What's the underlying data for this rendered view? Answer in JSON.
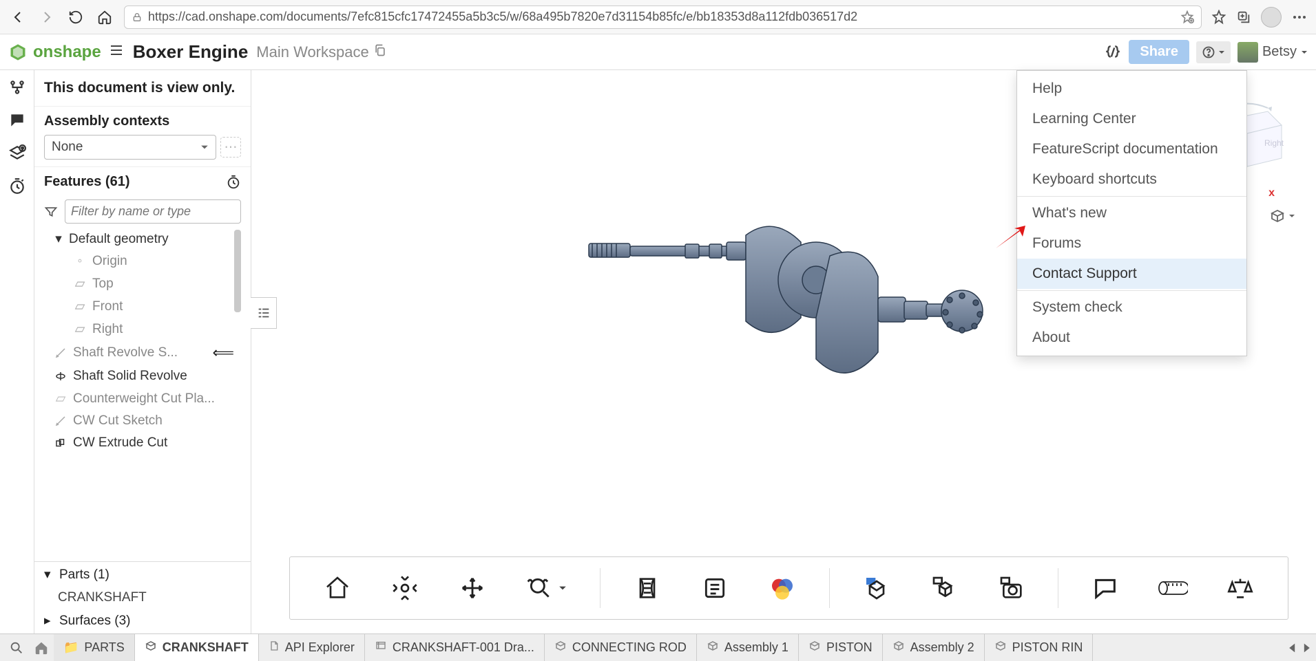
{
  "browser": {
    "url": "https://cad.onshape.com/documents/7efc815cfc17472455a5b3c5/w/68a495b7820e7d31154b85fc/e/bb18353d8a112fdb036517d2"
  },
  "header": {
    "brand": "onshape",
    "doc_title": "Boxer Engine",
    "workspace": "Main Workspace",
    "share_label": "Share",
    "user_name": "Betsy"
  },
  "banner": {
    "view_only": "This document is view only."
  },
  "contexts": {
    "title": "Assembly contexts",
    "selected": "None"
  },
  "features": {
    "title": "Features (61)",
    "filter_placeholder": "Filter by name or type",
    "default_geometry": "Default geometry",
    "items": {
      "origin": "Origin",
      "top": "Top",
      "front": "Front",
      "right": "Right",
      "shaft_rev_sketch": "Shaft Revolve S...",
      "shaft_solid_rev": "Shaft Solid Revolve",
      "cw_cut_plane": "Counterweight Cut Pla...",
      "cw_cut_sketch": "CW Cut Sketch",
      "cw_extrude_cut": "CW Extrude Cut"
    }
  },
  "parts": {
    "title": "Parts (1)",
    "item": "CRANKSHAFT",
    "surfaces": "Surfaces (3)"
  },
  "help_menu": {
    "help": "Help",
    "learning": "Learning Center",
    "fs_doc": "FeatureScript documentation",
    "shortcuts": "Keyboard shortcuts",
    "whats_new": "What's new",
    "forums": "Forums",
    "contact": "Contact Support",
    "system_check": "System check",
    "about": "About"
  },
  "axis": {
    "x": "x"
  },
  "tabs": {
    "parts_folder": "PARTS",
    "crankshaft": "CRANKSHAFT",
    "api_explorer": "API Explorer",
    "crankshaft_drawing": "CRANKSHAFT-001 Dra...",
    "connecting_rod": "CONNECTING ROD",
    "assembly1": "Assembly 1",
    "piston": "PISTON",
    "assembly2": "Assembly 2",
    "piston_ring": "PISTON RIN"
  }
}
